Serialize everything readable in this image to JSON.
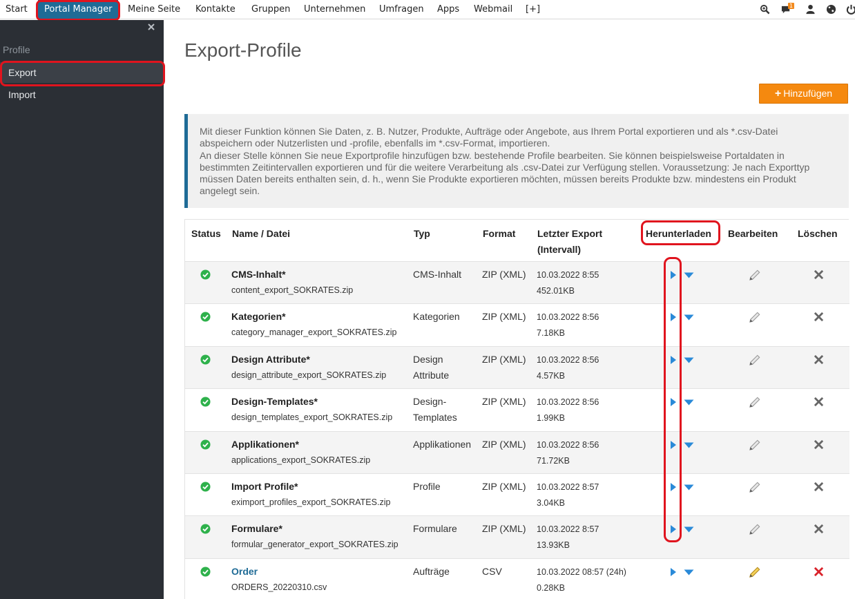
{
  "nav": {
    "items": [
      "Start",
      "Portal Manager",
      "Meine Seite",
      "Kontakte",
      "Gruppen",
      "Unternehmen",
      "Umfragen",
      "Apps",
      "Webmail",
      "[+]"
    ],
    "notifications_count": "1",
    "active_color": "#1f6b96",
    "icons": [
      "search-icon",
      "chat-icon",
      "user-icon",
      "globe-icon",
      "power-icon"
    ]
  },
  "sidebar": {
    "section_title": "Profile",
    "items": [
      {
        "label": "Export",
        "active": true
      },
      {
        "label": "Import",
        "active": false
      }
    ]
  },
  "main": {
    "title": "Export-Profile",
    "add_button_label": "Hinzufügen",
    "info_lines": [
      "Mit dieser Funktion können Sie Daten, z. B. Nutzer, Produkte, Aufträge oder Angebote, aus Ihrem Portal exportieren und als *.csv-Datei",
      "abspeichern oder Nutzerlisten und -profile, ebenfalls im *.csv-Format, importieren.",
      "An dieser Stelle können Sie neue Exportprofile hinzufügen bzw. bestehende Profile bearbeiten. Sie können beispielsweise Portaldaten in",
      "bestimmten Zeitintervallen exportieren und für die weitere Verarbeitung als .csv-Datei zur Verfügung stellen. Voraussetzung: Je nach Exporttyp",
      "müssen Daten bereits enthalten sein, d. h., wenn Sie Produkte exportieren möchten, müssen bereits Produkte bzw. mindestens ein Produkt",
      "angelegt sein."
    ]
  },
  "table": {
    "headers": {
      "status": "Status",
      "name": "Name / Datei",
      "type": "Typ",
      "format": "Format",
      "last_export_1": "Letzter Export",
      "last_export_2": "(Intervall)",
      "download": "Herunterladen",
      "edit": "Bearbeiten",
      "delete": "Löschen"
    },
    "rows": [
      {
        "name": "CMS-Inhalt*",
        "file": "content_export_SOKRATES.zip",
        "type_1": "CMS-Inhalt",
        "type_2": "",
        "format": "ZIP (XML)",
        "date": "10.03.2022 8:55",
        "size": "452.01KB"
      },
      {
        "name": "Kategorien*",
        "file": "category_manager_export_SOKRATES.zip",
        "type_1": "Kategorien",
        "type_2": "",
        "format": "ZIP (XML)",
        "date": "10.03.2022 8:56",
        "size": "7.18KB"
      },
      {
        "name": "Design Attribute*",
        "file": "design_attribute_export_SOKRATES.zip",
        "type_1": "Design",
        "type_2": "Attribute",
        "format": "ZIP (XML)",
        "date": "10.03.2022 8:56",
        "size": "4.57KB"
      },
      {
        "name": "Design-Templates*",
        "file": "design_templates_export_SOKRATES.zip",
        "type_1": "Design-",
        "type_2": "Templates",
        "format": "ZIP (XML)",
        "date": "10.03.2022 8:56",
        "size": "1.99KB"
      },
      {
        "name": "Applikationen*",
        "file": "applications_export_SOKRATES.zip",
        "type_1": "Applikationen",
        "type_2": "",
        "format": "ZIP (XML)",
        "date": "10.03.2022 8:56",
        "size": "71.72KB"
      },
      {
        "name": "Import Profile*",
        "file": "eximport_profiles_export_SOKRATES.zip",
        "type_1": "Profile",
        "type_2": "",
        "format": "ZIP (XML)",
        "date": "10.03.2022 8:57",
        "size": "3.04KB"
      },
      {
        "name": "Formulare*",
        "file": "formular_generator_export_SOKRATES.zip",
        "type_1": "Formulare",
        "type_2": "",
        "format": "ZIP (XML)",
        "date": "10.03.2022 8:57",
        "size": "13.93KB"
      },
      {
        "name": "Order",
        "file": "ORDERS_20220310.csv",
        "type_1": "Aufträge",
        "type_2": "",
        "format": "CSV",
        "date": "10.03.2022 08:57 (24h)",
        "size": "0.28KB"
      }
    ]
  }
}
